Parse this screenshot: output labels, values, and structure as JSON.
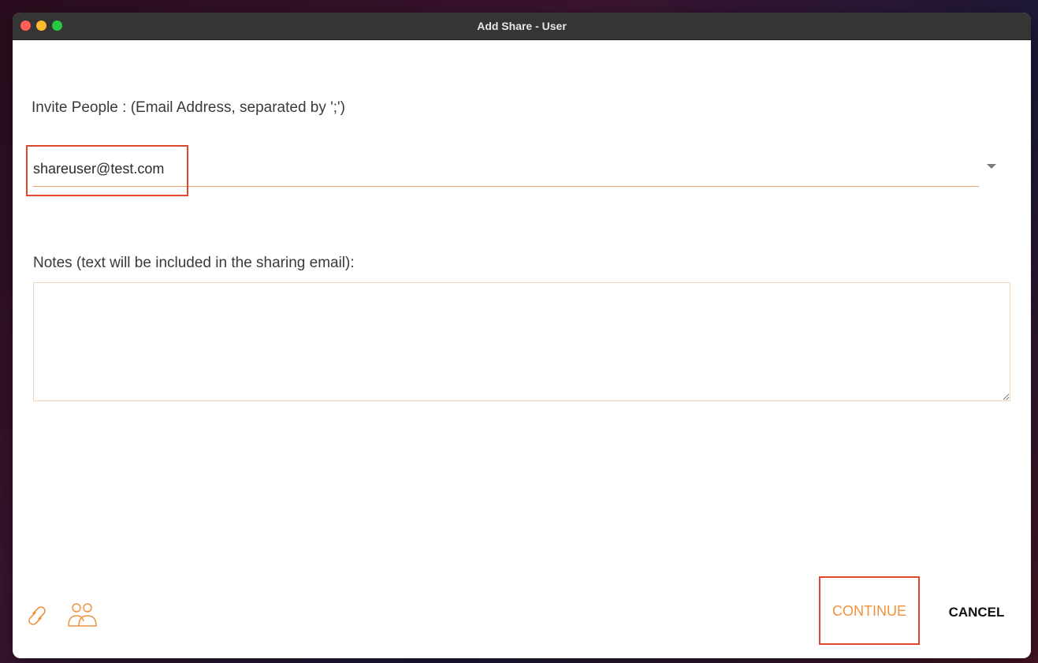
{
  "window": {
    "title": "Add Share - User"
  },
  "invite": {
    "label": "Invite People : (Email Address, separated by ';')",
    "value": "shareuser@test.com"
  },
  "notes": {
    "label": "Notes (text will be included in the sharing email):",
    "value": ""
  },
  "toolbar": {
    "icons": [
      "link-icon",
      "people-icon"
    ],
    "continue_label": "CONTINUE",
    "cancel_label": "CANCEL"
  },
  "colors": {
    "accent": "#f0923b",
    "highlight": "#e2452e",
    "titlebar": "#353535"
  }
}
